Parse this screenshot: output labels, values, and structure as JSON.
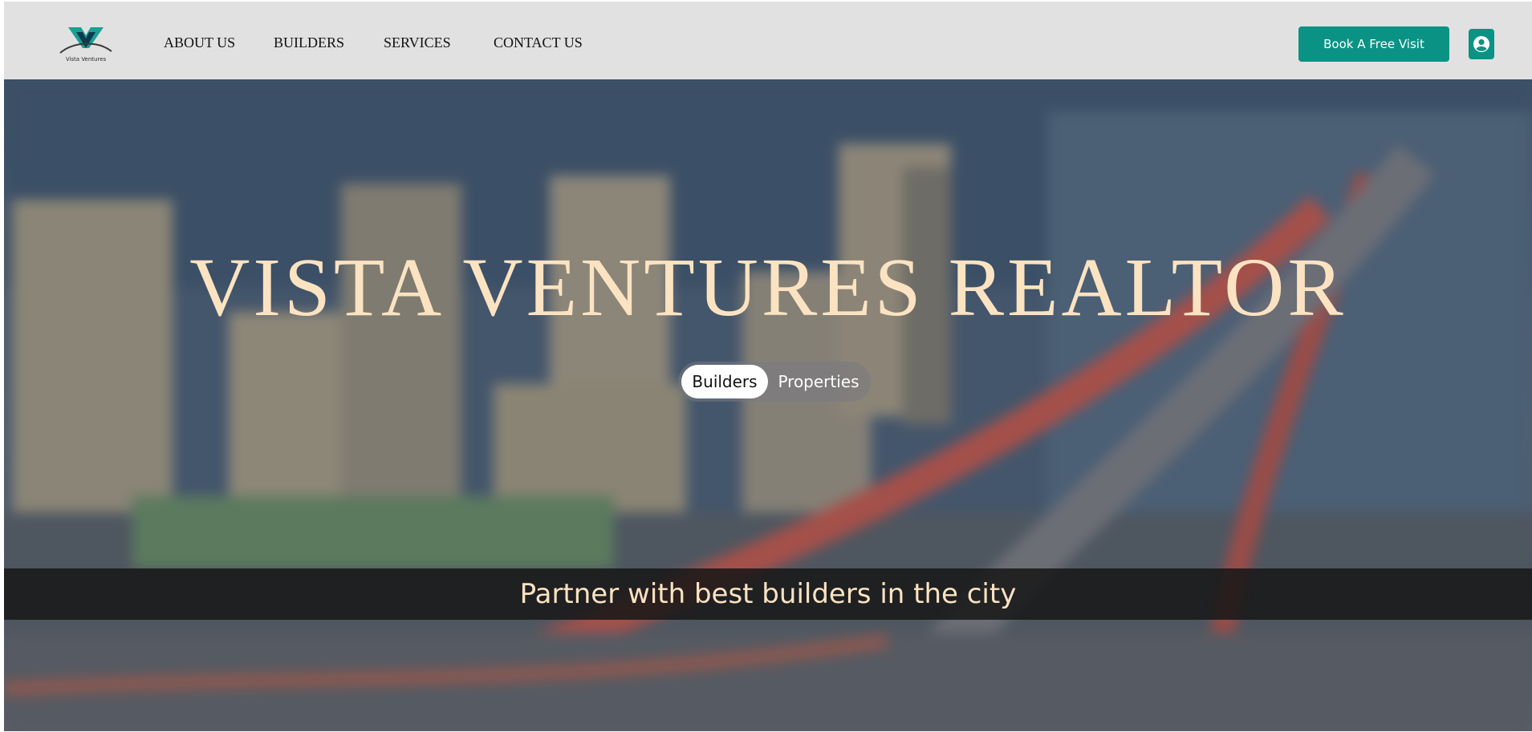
{
  "brand": {
    "logo_text": "Vista Ventures",
    "colors": {
      "header_bg": "#e1e1e1",
      "accent": "#0a9384",
      "hero_text": "#fbe3c2"
    }
  },
  "nav": {
    "items": [
      {
        "label": "ABOUT US"
      },
      {
        "label": "BUILDERS"
      },
      {
        "label": "SERVICES"
      },
      {
        "label": "CONTACT US"
      }
    ]
  },
  "header": {
    "cta_label": "Book A Free Visit",
    "account_icon": "user-circle-icon"
  },
  "hero": {
    "title": "VISTA VENTURES REALTOR",
    "toggle": {
      "options": [
        "Builders",
        "Properties"
      ],
      "selected": "Builders"
    },
    "tagline": "Partner with best builders in the city"
  }
}
